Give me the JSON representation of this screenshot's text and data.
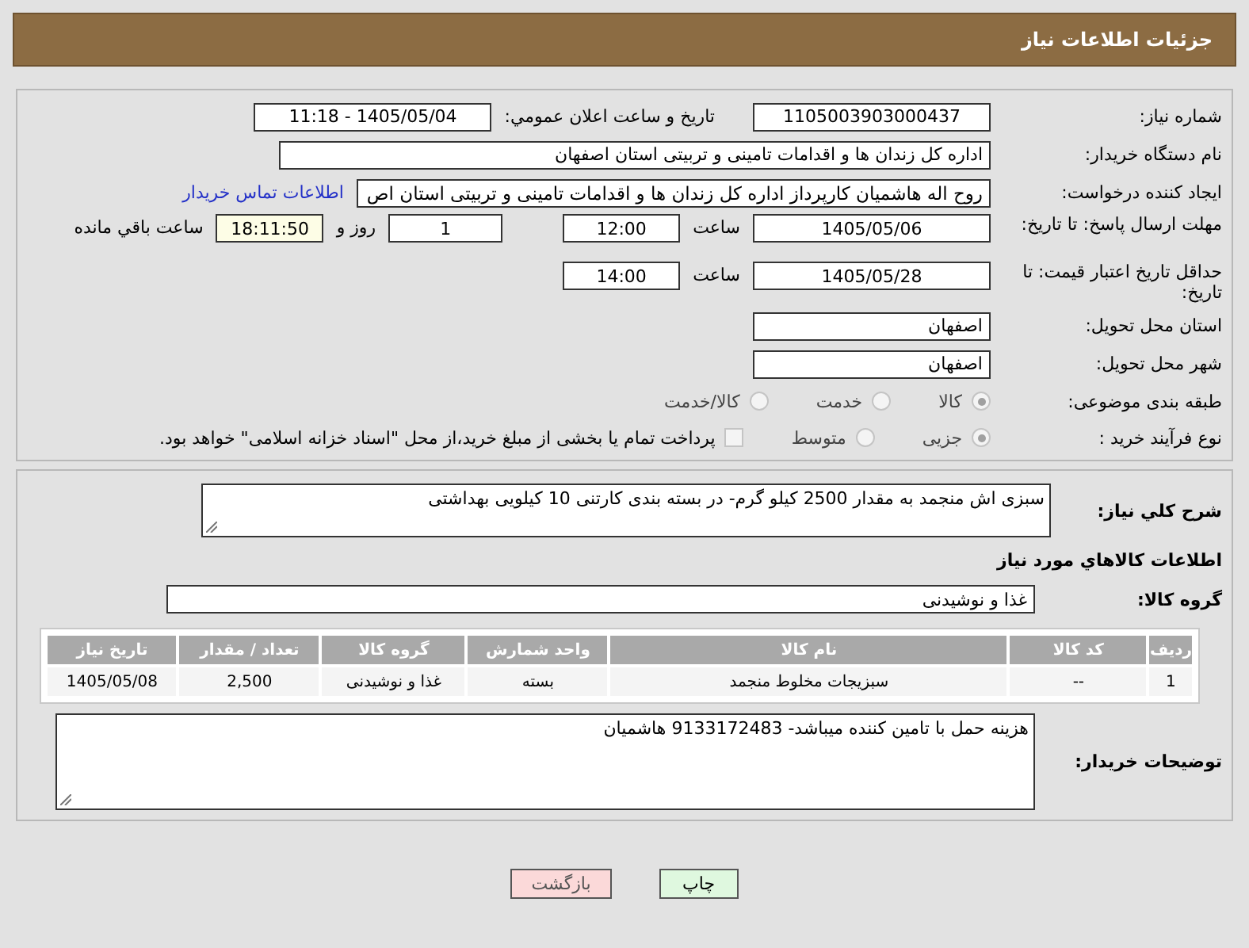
{
  "header": {
    "title": "جزئیات اطلاعات نیاز"
  },
  "details": {
    "need_number": {
      "label": "شماره نیاز:",
      "value": "1105003903000437"
    },
    "announce": {
      "label": "تاریخ و ساعت اعلان عمومي:",
      "value": "1405/05/04 - 11:18"
    },
    "buyer": {
      "label": "نام دستگاه خریدار:",
      "value": "اداره کل زندان ها و اقدامات تامینی و تربیتی استان اصفهان"
    },
    "creator": {
      "label": "ایجاد کننده درخواست:",
      "value": "روح اله هاشمیان کارپرداز اداره کل زندان ها و اقدامات تامینی و تربیتی استان اص",
      "link": "اطلاعات تماس خریدار"
    },
    "deadline": {
      "label": "مهلت ارسال پاسخ: تا تاریخ:",
      "date": "1405/05/06",
      "time_label": "ساعت",
      "time": "12:00",
      "days": "1",
      "days_label": "روز و",
      "remaining": "18:11:50",
      "remaining_label": "ساعت باقي مانده"
    },
    "validity": {
      "label": "حداقل تاریخ اعتبار قیمت: تا تاریخ:",
      "date": "1405/05/28",
      "time_label": "ساعت",
      "time": "14:00"
    },
    "province": {
      "label": "استان محل تحویل:",
      "value": "اصفهان"
    },
    "city": {
      "label": "شهر محل تحویل:",
      "value": "اصفهان"
    },
    "category": {
      "label": "طبقه بندی موضوعی:",
      "options": [
        {
          "label": "کالا",
          "selected": true
        },
        {
          "label": "خدمت",
          "selected": false
        },
        {
          "label": "کالا/خدمت",
          "selected": false
        }
      ]
    },
    "process": {
      "label": "نوع فرآیند خرید :",
      "options": [
        {
          "label": "جزیی",
          "selected": true
        },
        {
          "label": "متوسط",
          "selected": false
        }
      ],
      "treasury": {
        "label": "پرداخت تمام یا بخشی از مبلغ خرید،از محل \"اسناد خزانه اسلامی\" خواهد بود.",
        "checked": false
      }
    }
  },
  "summary": {
    "label": "شرح کلي نیاز:",
    "value": "سبزی اش منجمد به مقدار 2500 کیلو گرم- در بسته بندی کارتنی 10 کیلویی بهداشتی"
  },
  "goods_heading": "اطلاعات کالاهاي مورد نیاز",
  "goods_group": {
    "label": "گروه کالا:",
    "value": "غذا و نوشیدنی"
  },
  "table": {
    "columns": [
      "ردیف",
      "کد کالا",
      "نام کالا",
      "واحد شمارش",
      "گروه کالا",
      "تعداد / مقدار",
      "تاریخ نیاز"
    ],
    "rows": [
      [
        "1",
        "--",
        "سبزیجات مخلوط منجمد",
        "بسته",
        "غذا و نوشیدنی",
        "2,500",
        "1405/05/08"
      ]
    ]
  },
  "buyer_notes": {
    "label": "توضیحات خریدار:",
    "value": "هزینه حمل با تامین کننده میباشد- 9133172483 هاشمیان"
  },
  "buttons": [
    {
      "label": "چاپ",
      "kind": "print"
    },
    {
      "label": "بازگشت",
      "kind": "back"
    }
  ]
}
